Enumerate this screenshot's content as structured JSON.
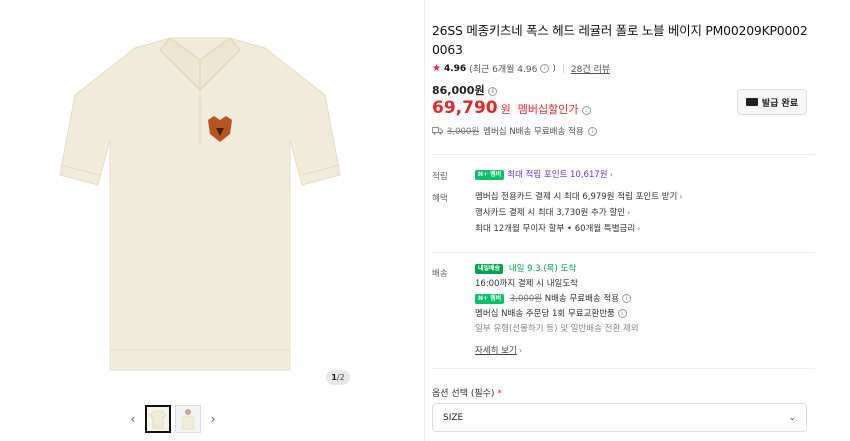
{
  "gallery": {
    "pager_current": "1",
    "pager_total": "/2",
    "prev_arrow": "‹",
    "next_arrow": "›",
    "image_color": "#f1ebd9"
  },
  "product": {
    "title": "26SS 메종키츠네 폭스 헤드 레귤러 폴로 노블 베이지 PM00209KP0002 0063",
    "rating": "4.96",
    "rating_detail": "(최근 6개월 4.96",
    "rating_detail_close": ")",
    "review_count": "28건 리뷰",
    "original_price": "86,000원",
    "sale_price": "69,790",
    "sale_unit": "원",
    "member_discount": "멤버십할인가",
    "coupon_button": "발급 완료",
    "shipping_strike": "3,000원",
    "shipping_note": "멤버십 N배송 무료배송 적용"
  },
  "benefits": {
    "points_label": "적립",
    "points_badge": "N+ 멤버",
    "points_text": "최대 적립 포인트 10,617원",
    "perks_label": "혜택",
    "perks": [
      "멤버십 전용카드 결제 시 최대 6,979원 적립 포인트 받기",
      "행사카드 결제 시 최대 3,730원 추가 할인",
      "최대 12개월 무이자 할부 • 60개월 특별금리"
    ]
  },
  "delivery": {
    "label": "배송",
    "badge": "내일배송",
    "date_text": "내일 9.3.(목) 도착",
    "cutoff": "16:00까지 결제 시 내일도착",
    "fee_strike": "3,000원",
    "fee_note": "N배송 무료배송 적용",
    "exchange_note": "멤버십 N배송 주문당 1회 무료교환반품",
    "exchange_sub": "일부 유형(선물하기 등) 및 일반배송 전환 제외",
    "more_link": "자세히 보기"
  },
  "options": {
    "label": "옵션 선택 (필수)",
    "required_mark": "*",
    "select_value": "SIZE"
  },
  "colors": {
    "accent_red": "#e5262c",
    "npay_green": "#08c168",
    "purple": "#6c35d6"
  }
}
